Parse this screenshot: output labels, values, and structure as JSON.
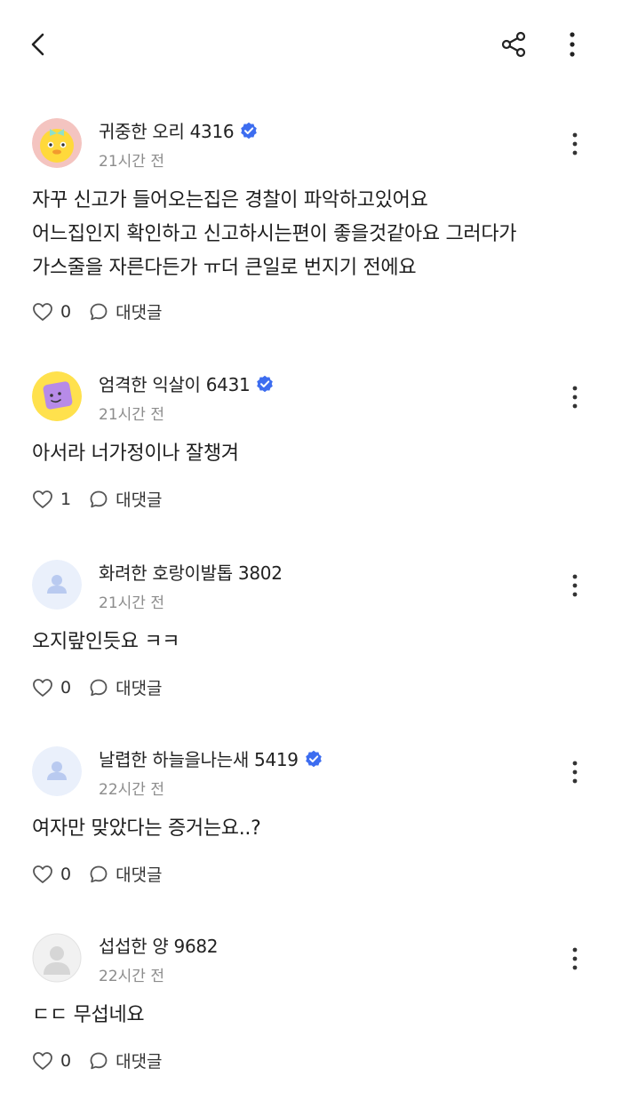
{
  "header": {
    "back_icon": "chevron-left-icon",
    "share_icon": "share-icon",
    "more_icon": "more-vertical-icon"
  },
  "colors": {
    "verified_badge": "#3d6df0",
    "text_primary": "#1e1e1e",
    "text_secondary": "#8c8c8c"
  },
  "reply_label": "대댓글",
  "comments": [
    {
      "nickname": "귀중한 오리 4316",
      "verified": true,
      "time": "21시간 전",
      "avatar": "duck-avatar",
      "lines": [
        "자꾸 신고가 들어오는집은 경찰이 파악하고있어요",
        "어느집인지 확인하고 신고하시는편이 좋을것같아요 그러다가",
        "가스줄을 자른다든가 ㅠ더 큰일로 번지기 전에요"
      ],
      "likes": "0"
    },
    {
      "nickname": "엄격한 익살이 6431",
      "verified": true,
      "time": "21시간 전",
      "avatar": "purple-block-avatar",
      "lines": [
        "아서라 너가정이나 잘챙겨"
      ],
      "likes": "1"
    },
    {
      "nickname": "화려한 호랑이발톱 3802",
      "verified": false,
      "time": "21시간 전",
      "avatar": "default-user-avatar",
      "lines": [
        "오지랖인듯요 ㅋㅋ"
      ],
      "likes": "0"
    },
    {
      "nickname": "날렵한 하늘을나는새 5419",
      "verified": true,
      "time": "22시간 전",
      "avatar": "default-user-avatar",
      "lines": [
        "여자만 맞았다는 증거는요..?"
      ],
      "likes": "0"
    },
    {
      "nickname": "섭섭한 양 9682",
      "verified": false,
      "time": "22시간 전",
      "avatar": "grey-user-avatar",
      "lines": [
        "ㄷㄷ 무섭네요"
      ],
      "likes": "0"
    }
  ]
}
